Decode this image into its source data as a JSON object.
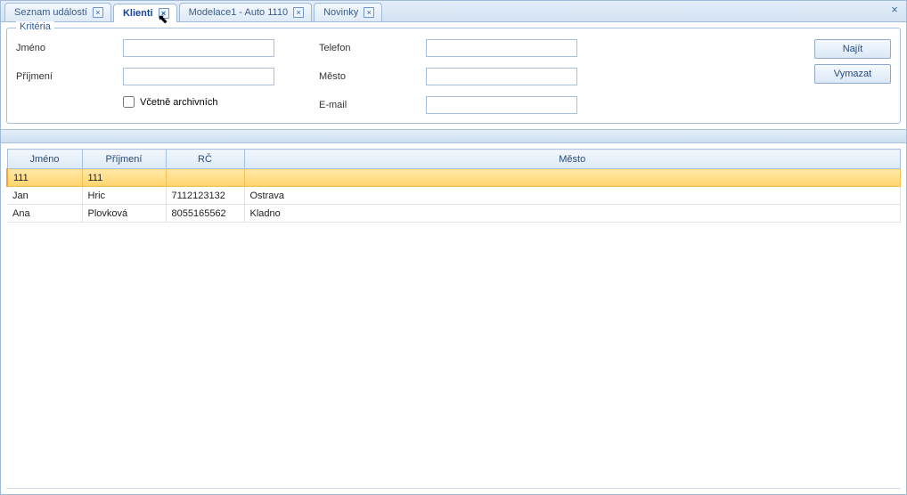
{
  "tabs": [
    {
      "label": "Seznam událostí",
      "active": false
    },
    {
      "label": "Klienti",
      "active": true
    },
    {
      "label": "Modelace1 - Auto 1110",
      "active": false
    },
    {
      "label": "Novinky",
      "active": false
    }
  ],
  "criteria": {
    "legend": "Kritéria",
    "rows_left": [
      {
        "label": "Jméno",
        "value": ""
      },
      {
        "label": "Příjmení",
        "value": ""
      }
    ],
    "rows_right": [
      {
        "label": "Telefon",
        "value": ""
      },
      {
        "label": "Město",
        "value": ""
      },
      {
        "label": "E-mail",
        "value": ""
      }
    ],
    "include_archive_label": "Včetně archivních",
    "include_archive_checked": false
  },
  "buttons": {
    "search": "Najít",
    "clear": "Vymazat"
  },
  "grid": {
    "columns": [
      "Jméno",
      "Příjmení",
      "RČ",
      "Město"
    ],
    "col_widths": [
      "84px",
      "94px",
      "88px",
      "auto"
    ],
    "rows": [
      {
        "cells": [
          "111",
          "111",
          "",
          ""
        ],
        "selected": true
      },
      {
        "cells": [
          "Jan",
          "Hric",
          "7112123132",
          "Ostrava"
        ],
        "selected": false
      },
      {
        "cells": [
          "Ana",
          "Plovková",
          "8055165562",
          "Kladno"
        ],
        "selected": false
      }
    ]
  }
}
